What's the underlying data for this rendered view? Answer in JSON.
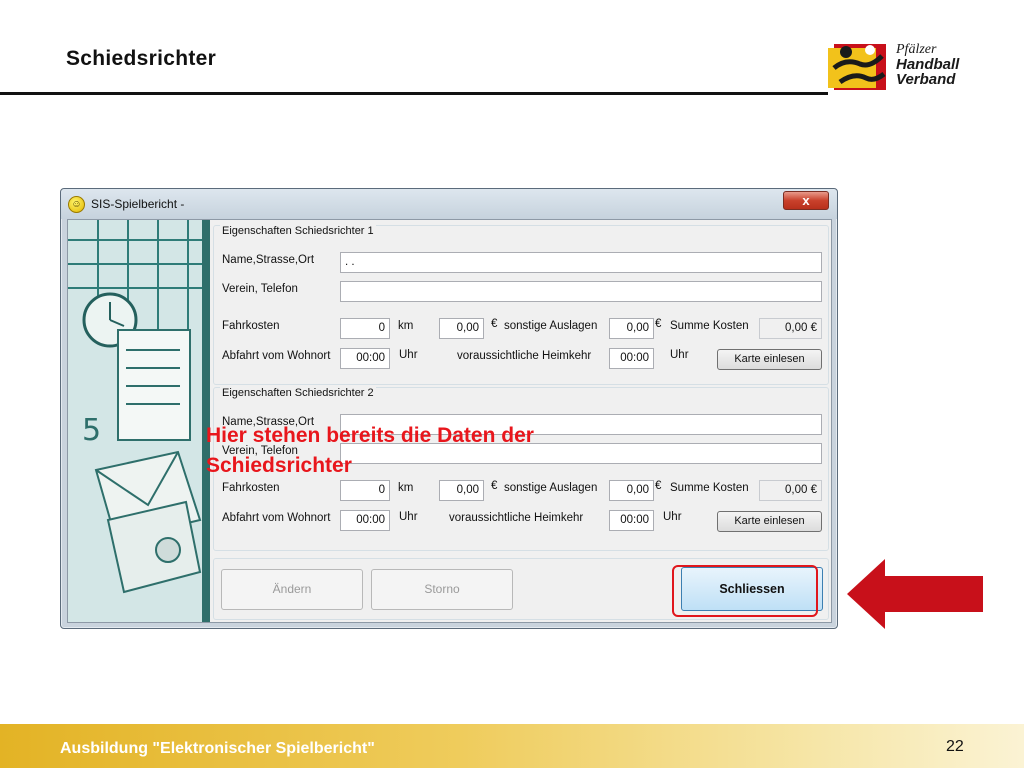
{
  "slide": {
    "title": "Schiedsrichter",
    "footer": "Ausbildung \"Elektronischer Spielbericht\"",
    "page_number": "22",
    "logo": {
      "line1": "Pfälzer",
      "line2": "Handball",
      "line3": "Verband"
    }
  },
  "window": {
    "title": "SIS-Spielbericht -",
    "close_label": "x",
    "group1": {
      "legend": "Eigenschaften Schiedsrichter 1",
      "name_label": "Name,Strasse,Ort",
      "name_value": ". .",
      "verein_label": "Verein, Telefon",
      "verein_value": "",
      "fahrkosten_label": "Fahrkosten",
      "fahrkosten_km_value": "0",
      "km_label": "km",
      "fahrkosten_euro_value": "0,00",
      "euro_label1": "€",
      "sonstige_label": "sonstige Auslagen",
      "sonstige_value": "0,00",
      "euro_label2": "€",
      "summe_label": "Summe Kosten",
      "summe_value": "0,00 €",
      "abfahrt_label": "Abfahrt vom Wohnort",
      "abfahrt_value": "00:00",
      "uhr_label1": "Uhr",
      "heimkehr_label": "voraussichtliche Heimkehr",
      "heimkehr_value": "00:00",
      "uhr_label2": "Uhr",
      "karte_button": "Karte einlesen"
    },
    "group2": {
      "legend": "Eigenschaften Schiedsrichter 2",
      "name_label": "Name,Strasse,Ort",
      "name_value": "",
      "verein_label": "Verein, Telefon",
      "verein_value": "",
      "fahrkosten_label": "Fahrkosten",
      "fahrkosten_km_value": "0",
      "km_label": "km",
      "fahrkosten_euro_value": "0,00",
      "euro_label1": "€",
      "sonstige_label": "sonstige Auslagen",
      "sonstige_value": "0,00",
      "euro_label2": "€",
      "summe_label": "Summe Kosten",
      "summe_value": "0,00 €",
      "abfahrt_label": "Abfahrt vom Wohnort",
      "abfahrt_value": "00:00",
      "uhr_label1": "Uhr",
      "heimkehr_label": "voraussichtliche Heimkehr",
      "heimkehr_value": "00:00",
      "uhr_label2": "Uhr",
      "karte_button": "Karte einlesen"
    },
    "buttons": {
      "aendern": "Ändern",
      "storno": "Storno",
      "schliessen": "Schliessen"
    }
  },
  "annotation": {
    "line1": "Hier stehen bereits die Daten der",
    "line2": "Schiedsrichter"
  },
  "colors": {
    "annotation": "#e8161c",
    "arrow": "#c8101a",
    "footer_gold": "#e3b325"
  }
}
